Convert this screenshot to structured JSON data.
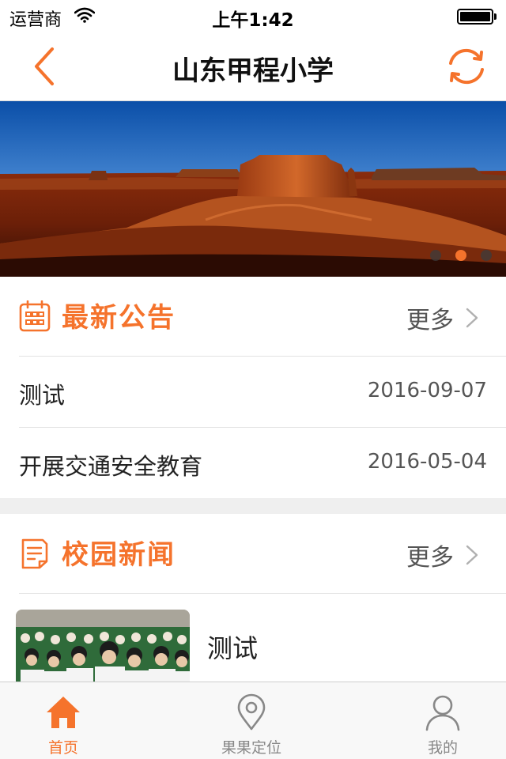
{
  "status_bar": {
    "carrier": "运营商",
    "time": "上午1:42"
  },
  "nav": {
    "title": "山东甲程小学"
  },
  "banner": {
    "slide_count": 3,
    "active_slide": 2
  },
  "announcements": {
    "title": "最新公告",
    "more": "更多",
    "items": [
      {
        "title": "测试",
        "date": "2016-09-07"
      },
      {
        "title": "开展交通安全教育",
        "date": "2016-05-04"
      }
    ]
  },
  "news": {
    "title": "校园新闻",
    "more": "更多",
    "items": [
      {
        "title": "测试"
      }
    ]
  },
  "tabs": [
    {
      "label": "首页",
      "icon": "home-icon",
      "active": true
    },
    {
      "label": "果果定位",
      "icon": "location-pin-icon",
      "active": false
    },
    {
      "label": "我的",
      "icon": "user-icon",
      "active": false
    }
  ],
  "colors": {
    "accent": "#f5732c",
    "text": "#222222",
    "muted": "#888888"
  }
}
